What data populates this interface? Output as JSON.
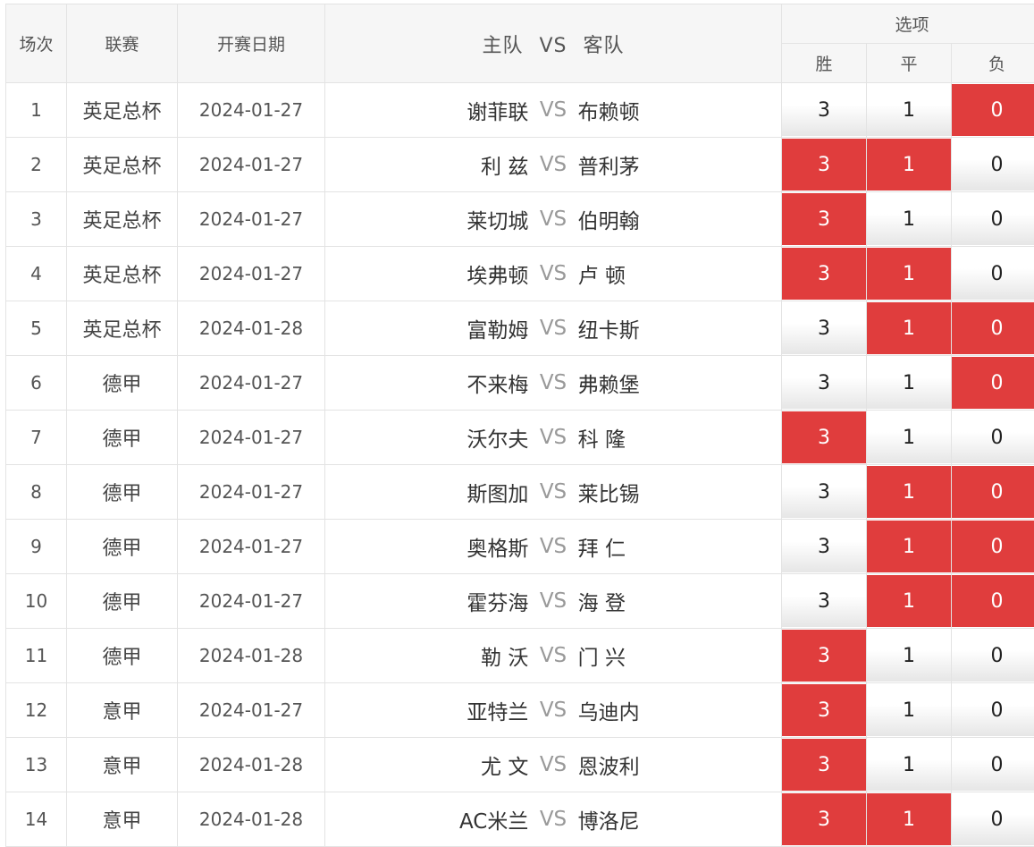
{
  "header": {
    "index": "场次",
    "league": "联赛",
    "date": "开赛日期",
    "home": "主队",
    "vs": "VS",
    "away": "客队",
    "options": "选项",
    "win": "胜",
    "draw": "平",
    "lose": "负"
  },
  "colors": {
    "selected": "#e03d3d",
    "header_bg": "#f6f6f6"
  },
  "matches": [
    {
      "no": "1",
      "league": "英足总杯",
      "date": "2024-01-27",
      "home": "谢菲联",
      "vs": "VS",
      "away": "布赖顿",
      "w": "3",
      "d": "1",
      "l": "0",
      "sel": [
        false,
        false,
        true
      ]
    },
    {
      "no": "2",
      "league": "英足总杯",
      "date": "2024-01-27",
      "home": "利 兹",
      "vs": "VS",
      "away": "普利茅",
      "w": "3",
      "d": "1",
      "l": "0",
      "sel": [
        true,
        true,
        false
      ]
    },
    {
      "no": "3",
      "league": "英足总杯",
      "date": "2024-01-27",
      "home": "莱切城",
      "vs": "VS",
      "away": "伯明翰",
      "w": "3",
      "d": "1",
      "l": "0",
      "sel": [
        true,
        false,
        false
      ]
    },
    {
      "no": "4",
      "league": "英足总杯",
      "date": "2024-01-27",
      "home": "埃弗顿",
      "vs": "VS",
      "away": "卢 顿",
      "w": "3",
      "d": "1",
      "l": "0",
      "sel": [
        true,
        true,
        false
      ]
    },
    {
      "no": "5",
      "league": "英足总杯",
      "date": "2024-01-28",
      "home": "富勒姆",
      "vs": "VS",
      "away": "纽卡斯",
      "w": "3",
      "d": "1",
      "l": "0",
      "sel": [
        false,
        true,
        true
      ]
    },
    {
      "no": "6",
      "league": "德甲",
      "date": "2024-01-27",
      "home": "不来梅",
      "vs": "VS",
      "away": "弗赖堡",
      "w": "3",
      "d": "1",
      "l": "0",
      "sel": [
        false,
        false,
        true
      ]
    },
    {
      "no": "7",
      "league": "德甲",
      "date": "2024-01-27",
      "home": "沃尔夫",
      "vs": "VS",
      "away": "科 隆",
      "w": "3",
      "d": "1",
      "l": "0",
      "sel": [
        true,
        false,
        false
      ]
    },
    {
      "no": "8",
      "league": "德甲",
      "date": "2024-01-27",
      "home": "斯图加",
      "vs": "VS",
      "away": "莱比锡",
      "w": "3",
      "d": "1",
      "l": "0",
      "sel": [
        false,
        true,
        true
      ]
    },
    {
      "no": "9",
      "league": "德甲",
      "date": "2024-01-27",
      "home": "奥格斯",
      "vs": "VS",
      "away": "拜 仁",
      "w": "3",
      "d": "1",
      "l": "0",
      "sel": [
        false,
        true,
        true
      ]
    },
    {
      "no": "10",
      "league": "德甲",
      "date": "2024-01-27",
      "home": "霍芬海",
      "vs": "VS",
      "away": "海 登",
      "w": "3",
      "d": "1",
      "l": "0",
      "sel": [
        false,
        true,
        true
      ]
    },
    {
      "no": "11",
      "league": "德甲",
      "date": "2024-01-28",
      "home": "勒 沃",
      "vs": "VS",
      "away": "门 兴",
      "w": "3",
      "d": "1",
      "l": "0",
      "sel": [
        true,
        false,
        false
      ]
    },
    {
      "no": "12",
      "league": "意甲",
      "date": "2024-01-27",
      "home": "亚特兰",
      "vs": "VS",
      "away": "乌迪内",
      "w": "3",
      "d": "1",
      "l": "0",
      "sel": [
        true,
        false,
        false
      ]
    },
    {
      "no": "13",
      "league": "意甲",
      "date": "2024-01-28",
      "home": "尤 文",
      "vs": "VS",
      "away": "恩波利",
      "w": "3",
      "d": "1",
      "l": "0",
      "sel": [
        true,
        false,
        false
      ]
    },
    {
      "no": "14",
      "league": "意甲",
      "date": "2024-01-28",
      "home": "AC米兰",
      "vs": "VS",
      "away": "博洛尼",
      "w": "3",
      "d": "1",
      "l": "0",
      "sel": [
        true,
        true,
        false
      ]
    }
  ]
}
